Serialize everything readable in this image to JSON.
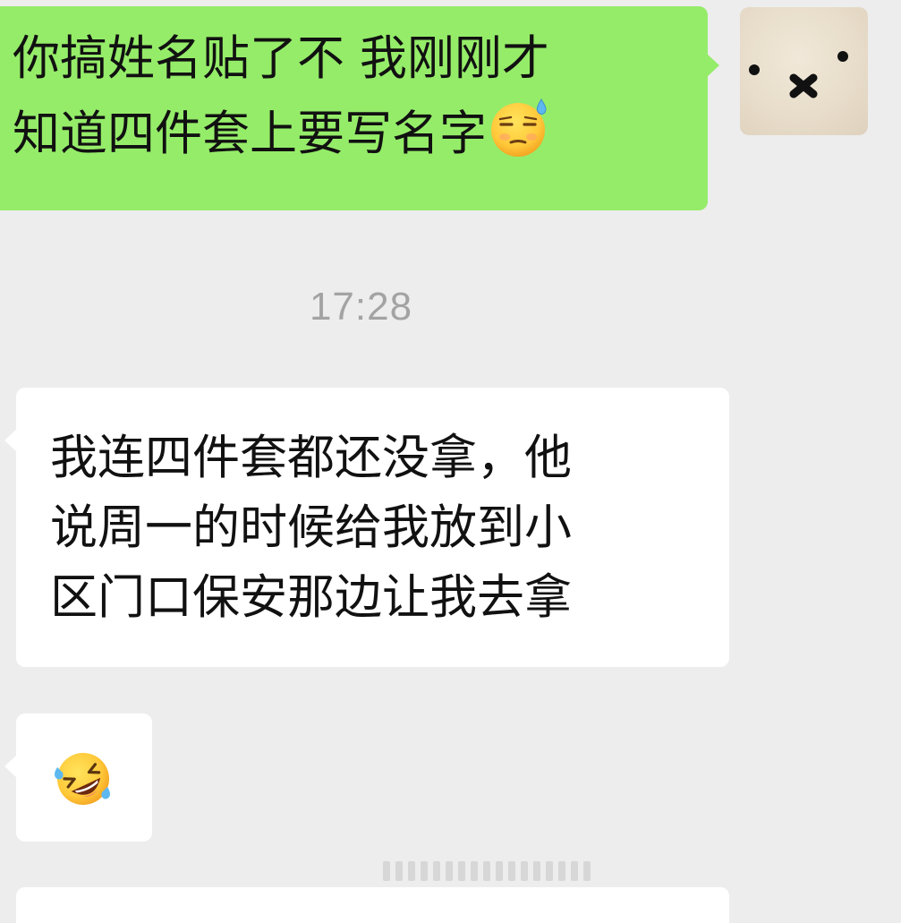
{
  "messages": [
    {
      "sender": "self",
      "text": "你搞姓名贴了不 我刚刚才\n知道四件套上要写名字",
      "emoji": "sleepy-sweat-emoji"
    },
    {
      "type": "timestamp",
      "text": "17:28"
    },
    {
      "sender": "other",
      "text": "我连四件套都还没拿，他\n说周一的时候给我放到小\n区门口保安那边让我去拿"
    },
    {
      "sender": "other",
      "emoji": "rolling-on-floor-laughing-emoji"
    }
  ],
  "colors": {
    "background": "#EDEDED",
    "outgoing_bubble": "#95EC69",
    "incoming_bubble": "#FFFFFF",
    "timestamp_text": "#A3A3A3",
    "message_text": "#111111"
  }
}
